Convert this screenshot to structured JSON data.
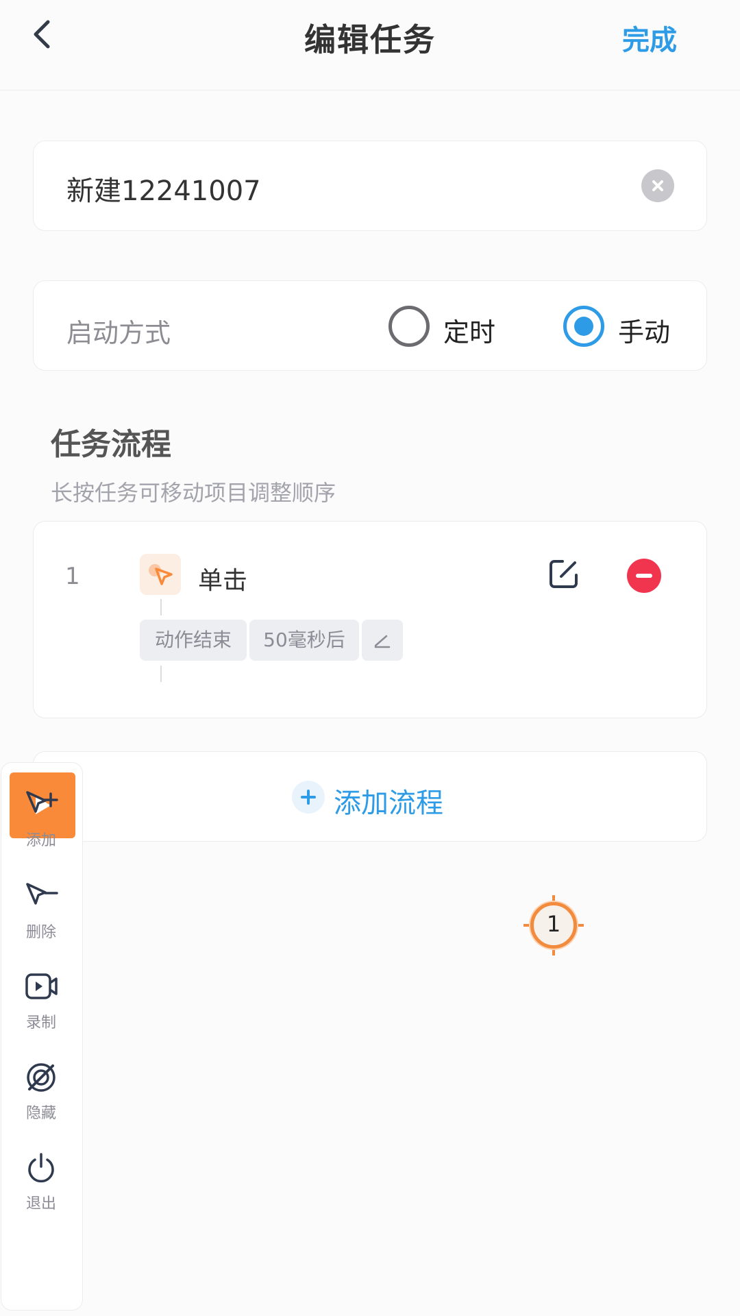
{
  "header": {
    "title": "编辑任务",
    "done_label": "完成"
  },
  "task_name": {
    "value": "新建12241007"
  },
  "launch_mode": {
    "label": "启动方式",
    "options": [
      {
        "label": "定时",
        "selected": false
      },
      {
        "label": "手动",
        "selected": true
      }
    ]
  },
  "flow_section": {
    "title": "任务流程",
    "hint": "长按任务可移动项目调整顺序"
  },
  "flow_steps": [
    {
      "index": "1",
      "action": "单击",
      "icon": "pointer-click-icon",
      "end_condition": "动作结束",
      "delay": "50毫秒后"
    }
  ],
  "add_flow": {
    "label": "添加流程"
  },
  "toolbar": {
    "items": [
      {
        "label": "添加",
        "icon": "pointer-add-icon"
      },
      {
        "label": "删除",
        "icon": "pointer-remove-icon"
      },
      {
        "label": "录制",
        "icon": "record-icon"
      },
      {
        "label": "隐藏",
        "icon": "hide-icon"
      },
      {
        "label": "退出",
        "icon": "power-icon"
      }
    ]
  },
  "target_marker": {
    "number": "1"
  },
  "colors": {
    "accent": "#2d9be5",
    "orange": "#f98a3a",
    "danger": "#f2354f"
  }
}
